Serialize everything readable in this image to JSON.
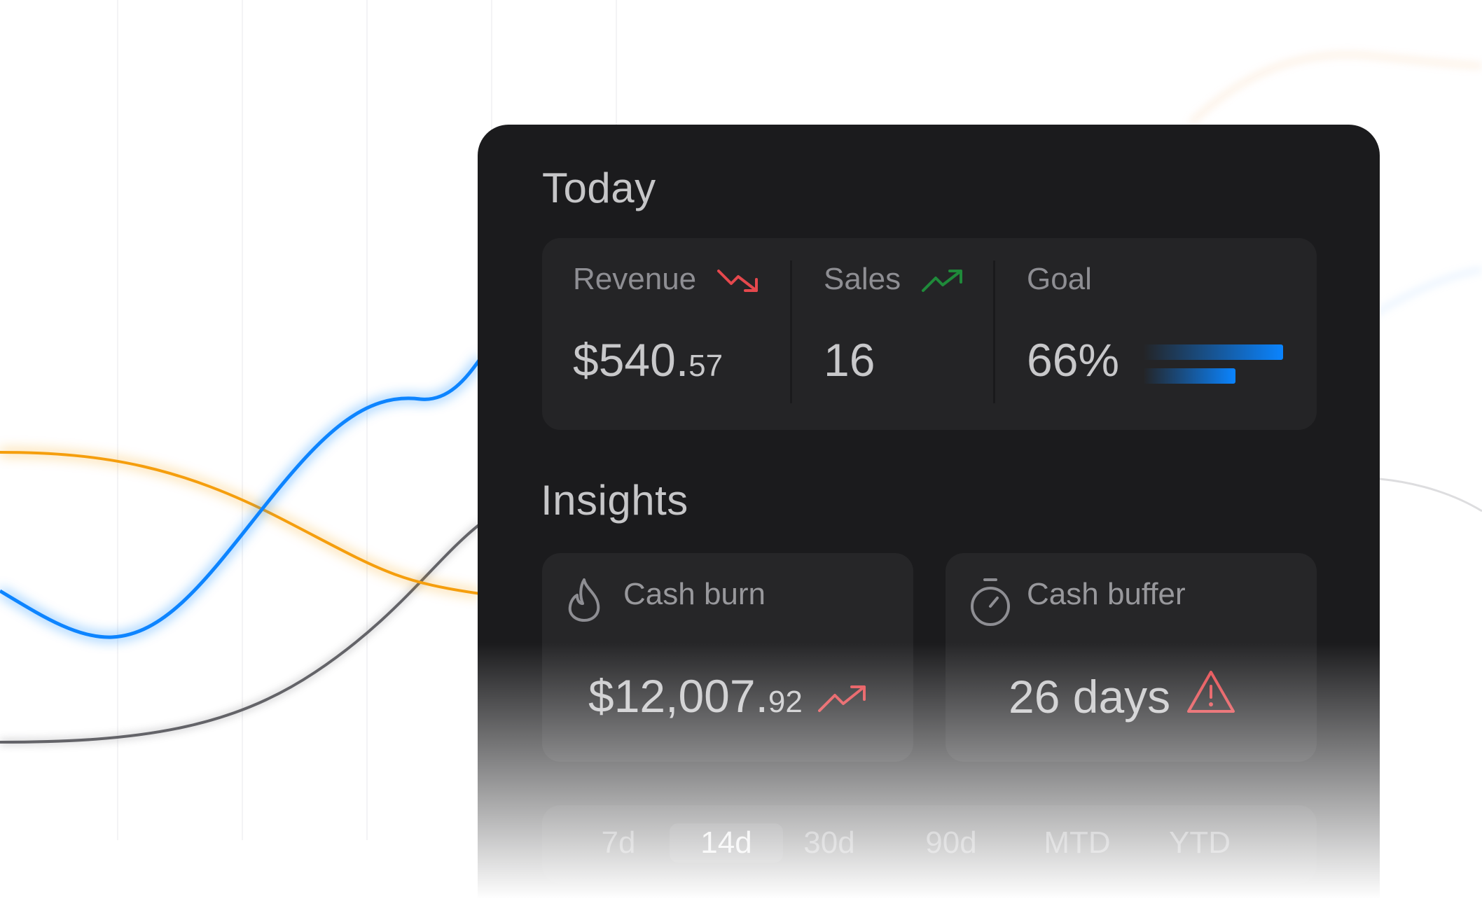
{
  "today": {
    "title": "Today",
    "revenue": {
      "label": "Revenue",
      "value_main": "$540.",
      "value_cents": "57",
      "trend": "down",
      "trend_color": "#e5484d"
    },
    "sales": {
      "label": "Sales",
      "value": "16",
      "trend": "up",
      "trend_color": "#1f8a3a"
    },
    "goal": {
      "label": "Goal",
      "value": "66%",
      "bars": [
        1.0,
        0.66
      ],
      "bar_color": "#0a84ff"
    }
  },
  "insights": {
    "title": "Insights",
    "cash_burn": {
      "label": "Cash burn",
      "icon": "flame-icon",
      "value_main": "$12,007.",
      "value_cents": "92",
      "trend": "up",
      "trend_color": "#e5484d"
    },
    "cash_buffer": {
      "label": "Cash buffer",
      "icon": "stopwatch-icon",
      "value": "26 days",
      "alert": "warning-icon",
      "alert_color": "#e5484d"
    }
  },
  "range": {
    "options": [
      "7d",
      "14d",
      "30d",
      "90d",
      "MTD",
      "YTD"
    ],
    "selected": "14d"
  },
  "colors": {
    "blue": "#0a84ff",
    "orange": "#f59e0b",
    "gray": "#5a5a5e",
    "panel": "#1b1b1d"
  }
}
